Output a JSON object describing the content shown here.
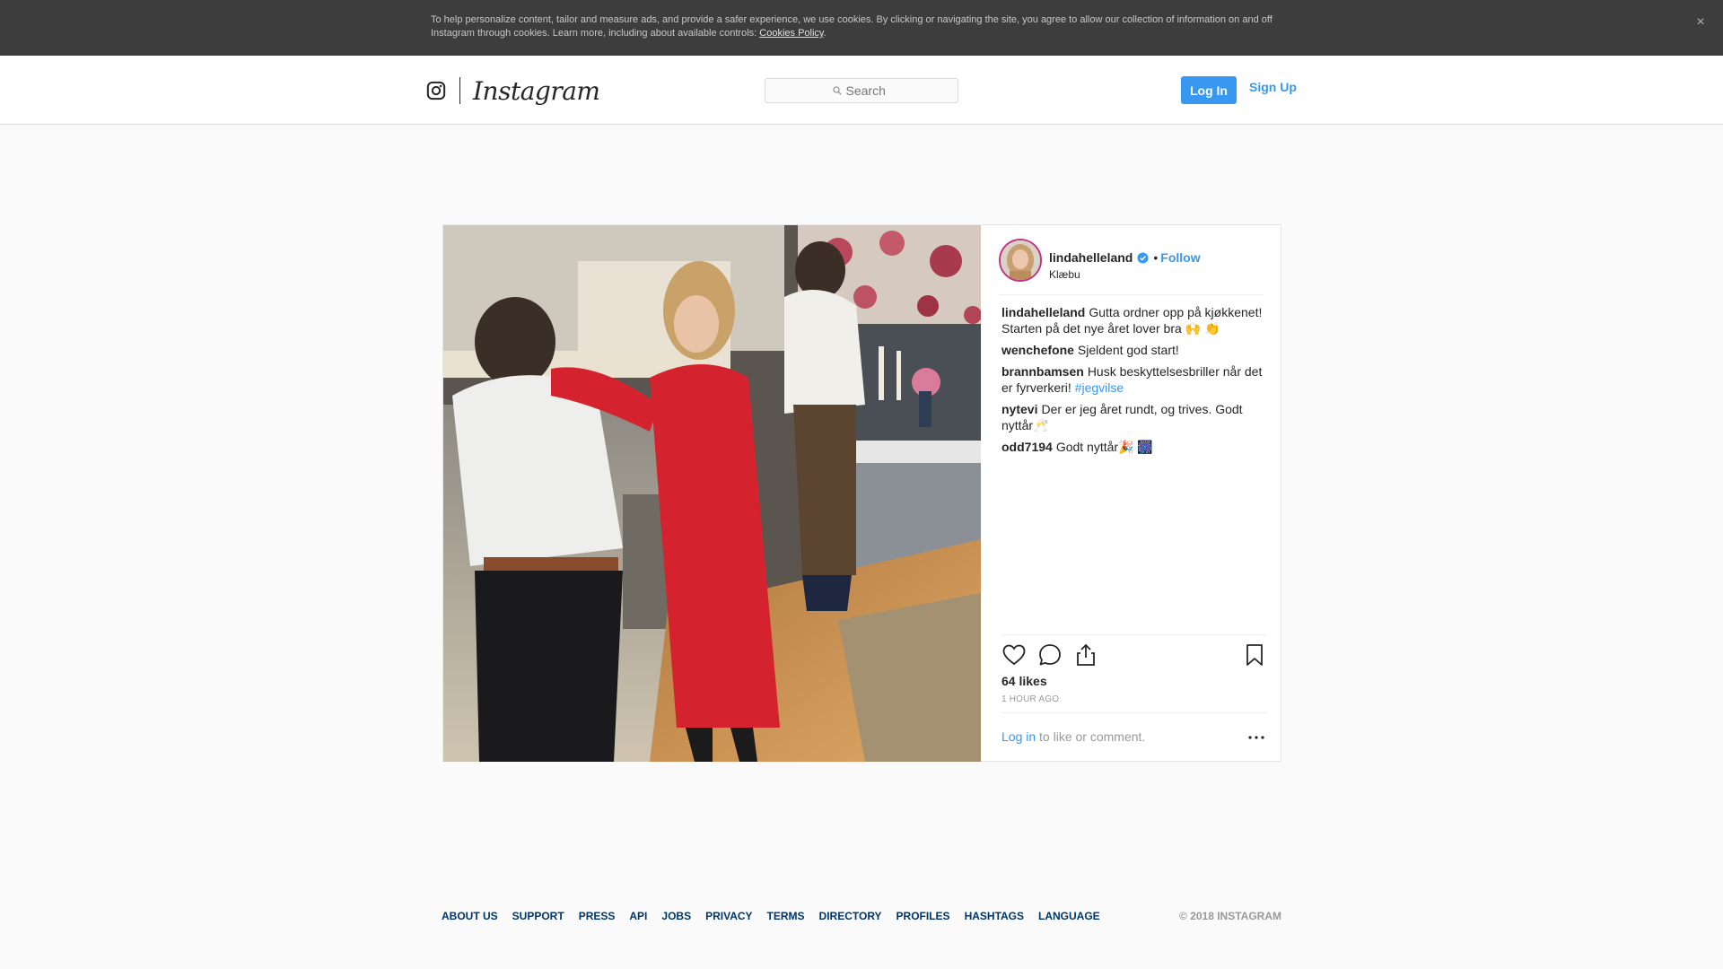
{
  "cookie_banner": {
    "text": "To help personalize content, tailor and measure ads, and provide a safer experience, we use cookies. By clicking or navigating the site, you agree to allow our collection of information on and off Instagram through cookies. Learn more, including about available controls: ",
    "link_text": "Cookies Policy",
    "link_suffix": ".",
    "close_glyph": "×"
  },
  "header": {
    "wordmark": "Instagram",
    "search_placeholder": "Search",
    "login_label": "Log In",
    "signup_label": "Sign Up"
  },
  "post": {
    "author": {
      "username": "lindahelleland",
      "verified": true,
      "separator": "•",
      "follow_label": "Follow",
      "location": "Klæbu"
    },
    "comments": [
      {
        "user": "lindahelleland",
        "text": "Gutta ordner opp på kjøkkenet! Starten på det nye året lover bra 🙌 👏"
      },
      {
        "user": "wenchefone",
        "text": "Sjeldent god start!"
      },
      {
        "user": "brannbamsen",
        "text": "Husk beskyttelsesbriller når det er fyrverkeri! ",
        "hashtag": "#jegvilse"
      },
      {
        "user": "nytevi",
        "text": "Der er jeg året rundt, og trives. Godt nyttår🥂"
      },
      {
        "user": "odd7194",
        "text": "Godt nyttår🎉 🎆"
      }
    ],
    "likes": "64 likes",
    "time": "1 HOUR AGO",
    "comment_prompt_link": "Log in",
    "comment_prompt_rest": " to like or comment.",
    "icons": {
      "like": "heart-icon",
      "comment": "comment-bubble-icon",
      "share": "share-icon",
      "save": "bookmark-icon",
      "more": "more-options-icon"
    }
  },
  "footer": {
    "links": [
      "ABOUT US",
      "SUPPORT",
      "PRESS",
      "API",
      "JOBS",
      "PRIVACY",
      "TERMS",
      "DIRECTORY",
      "PROFILES",
      "HASHTAGS",
      "LANGUAGE"
    ],
    "copyright": "© 2018 INSTAGRAM"
  },
  "colors": {
    "accent_blue": "#3897f0",
    "link_navy": "#003569",
    "banner_bg": "#3d3d3d"
  }
}
